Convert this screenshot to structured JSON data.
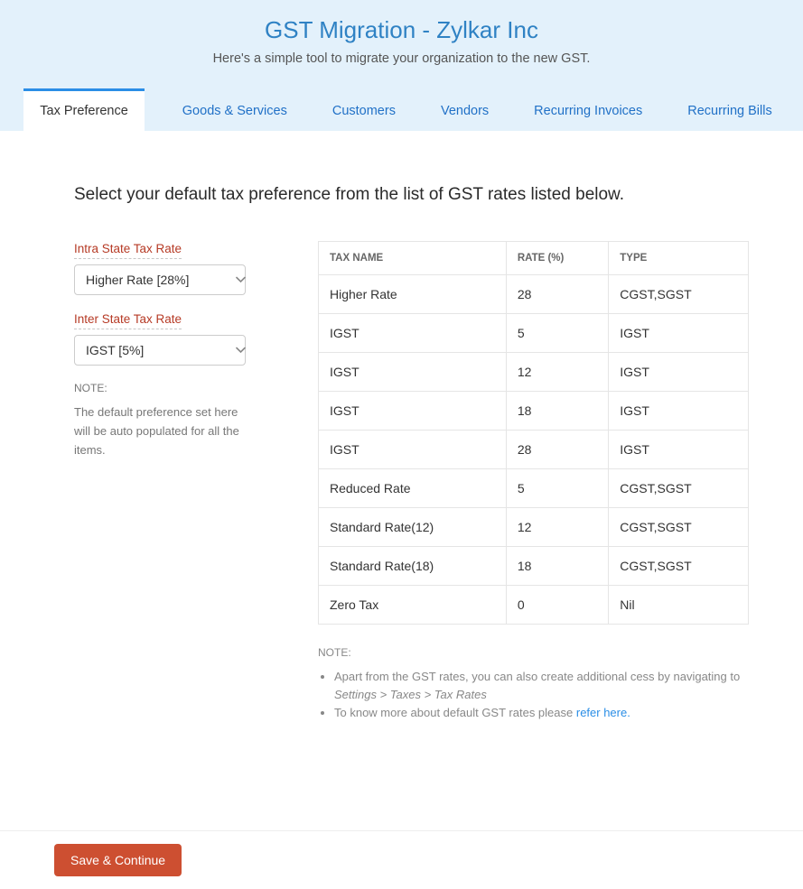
{
  "header": {
    "title": "GST Migration - Zylkar Inc",
    "subtitle": "Here's a simple tool to migrate your organization to the new GST."
  },
  "tabs": [
    {
      "label": "Tax Preference",
      "active": true
    },
    {
      "label": "Goods & Services",
      "active": false
    },
    {
      "label": "Customers",
      "active": false
    },
    {
      "label": "Vendors",
      "active": false
    },
    {
      "label": "Recurring Invoices",
      "active": false
    },
    {
      "label": "Recurring Bills",
      "active": false
    }
  ],
  "main": {
    "heading": "Select your default tax preference from the list of GST rates listed below.",
    "intra_state": {
      "label": "Intra State Tax Rate",
      "value": "Higher Rate [28%]"
    },
    "inter_state": {
      "label": "Inter State Tax Rate",
      "value": "IGST [5%]"
    },
    "left_note_label": "NOTE:",
    "left_note_text": "The default preference set here will be auto populated for all the items.",
    "table": {
      "headers": {
        "name": "TAX NAME",
        "rate": "RATE (%)",
        "type": "TYPE"
      },
      "rows": [
        {
          "name": "Higher Rate",
          "rate": "28",
          "type": "CGST,SGST"
        },
        {
          "name": "IGST",
          "rate": "5",
          "type": "IGST"
        },
        {
          "name": "IGST",
          "rate": "12",
          "type": "IGST"
        },
        {
          "name": "IGST",
          "rate": "18",
          "type": "IGST"
        },
        {
          "name": "IGST",
          "rate": "28",
          "type": "IGST"
        },
        {
          "name": "Reduced Rate",
          "rate": "5",
          "type": "CGST,SGST"
        },
        {
          "name": "Standard Rate(12)",
          "rate": "12",
          "type": "CGST,SGST"
        },
        {
          "name": "Standard Rate(18)",
          "rate": "18",
          "type": "CGST,SGST"
        },
        {
          "name": "Zero Tax",
          "rate": "0",
          "type": "Nil"
        }
      ]
    },
    "right_note_label": "NOTE:",
    "bullet1_a": "Apart from the GST rates, you can also create additional cess by navigating to ",
    "bullet1_b": "Settings > Taxes > Tax Rates",
    "bullet2_a": "To know more about default GST rates please ",
    "bullet2_link": "refer here."
  },
  "footer": {
    "save_label": "Save & Continue"
  }
}
